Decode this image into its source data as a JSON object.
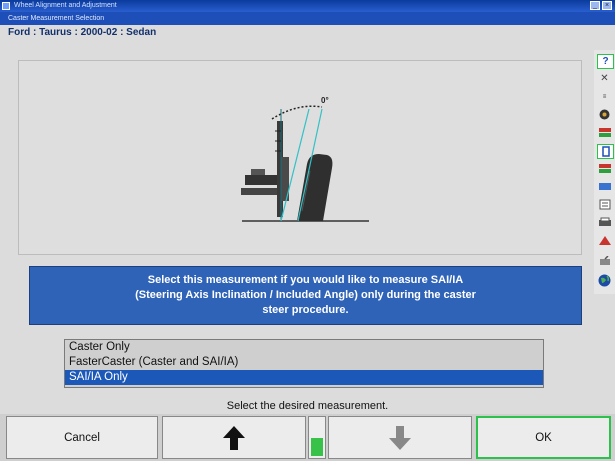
{
  "colors": {
    "title_blue": "#1e4fb8",
    "info_blue": "#2f63b8",
    "selected_blue": "#1c58b8",
    "ok_green": "#2ac24a",
    "level_green": "#38c24a"
  },
  "window": {
    "title": "Wheel Alignment and Adjustment",
    "subtitle": "Caster Measurement Selection"
  },
  "vehicle": {
    "label": "Ford : Taurus : 2000-02 : Sedan"
  },
  "diagram": {
    "angle_label": "0°"
  },
  "info": {
    "line1": "Select this measurement if you would like to measure SAI/IA",
    "line2": "(Steering Axis Inclination / Included Angle) only during the caster",
    "line3": "steer procedure."
  },
  "options": {
    "items": [
      "Caster Only",
      "FasterCaster (Caster and SAI/IA)",
      "SAI/IA Only"
    ],
    "selected": "SAI/IA Only"
  },
  "prompt": "Select the desired measurement.",
  "buttons": {
    "cancel": "Cancel",
    "ok": "OK",
    "up_icon": "arrow-up-icon",
    "down_icon": "arrow-down-icon"
  },
  "level_indicator": {
    "fill_fraction": 0.45
  },
  "sidebar_icons": [
    "help-icon",
    "tools-icon",
    "specs-icon",
    "wheel-icon",
    "vehicle-icon",
    "measure-icon",
    "adjust-icon",
    "readings-icon",
    "report-icon",
    "print-icon",
    "caster-icon",
    "sensor-icon",
    "globe-icon"
  ]
}
